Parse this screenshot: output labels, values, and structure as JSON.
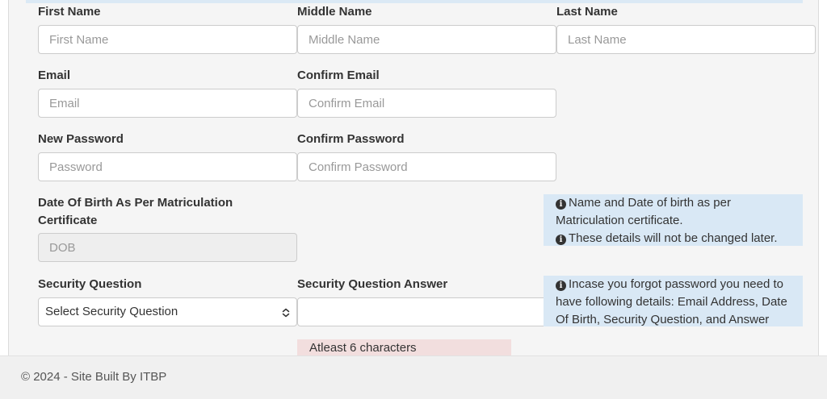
{
  "form": {
    "first_name": {
      "label": "First Name",
      "placeholder": "First Name"
    },
    "middle_name": {
      "label": "Middle Name",
      "placeholder": "Middle Name"
    },
    "last_name": {
      "label": "Last Name",
      "placeholder": "Last Name"
    },
    "email": {
      "label": "Email",
      "placeholder": "Email"
    },
    "confirm_email": {
      "label": "Confirm Email",
      "placeholder": "Confirm Email"
    },
    "new_password": {
      "label": "New Password",
      "placeholder": "Password"
    },
    "confirm_password": {
      "label": "Confirm Password",
      "placeholder": "Confirm Password"
    },
    "dob": {
      "label_line1": "Date Of Birth As Per Matriculation",
      "label_line2": "Certificate",
      "placeholder": "DOB"
    },
    "security_question": {
      "label": "Security Question",
      "selected": "Select Security Question"
    },
    "security_answer": {
      "label": "Security Question Answer",
      "value": "",
      "error": "Atleast 6 characters"
    }
  },
  "notes": {
    "dob_note": {
      "line1": "Name and Date of birth as per",
      "line2": "Matriculation certificate.",
      "line3": "These details will not be changed later."
    },
    "security_note": {
      "line1": "Incase you forgot password you need to",
      "line2": "have following details: Email Address, Date",
      "line3": "Of Birth, Security Question, and Answer"
    }
  },
  "icons": {
    "info": "info-circle-icon",
    "select": "chevron-updown-icon"
  },
  "footer": {
    "text": "© 2024 - Site Built By ITBP"
  },
  "colors": {
    "info_bg": "#d9e8f5",
    "error_bg": "#f2dede",
    "panel_bg": "#f5f5f5",
    "footer_bg": "#f0f0f0"
  }
}
